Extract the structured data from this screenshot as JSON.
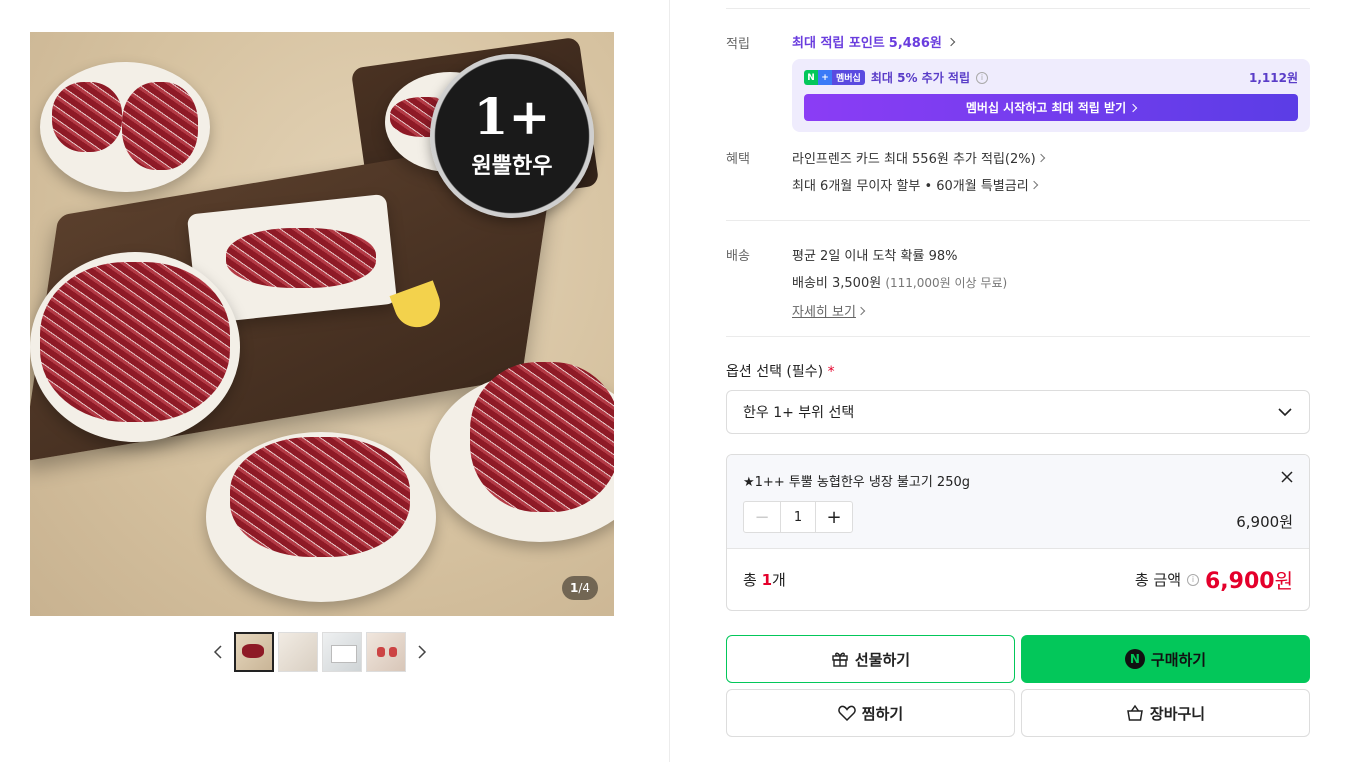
{
  "gallery": {
    "badge_main": "1+",
    "badge_sub": "원뿔한우",
    "counter_current": "1",
    "counter_sep": "/",
    "counter_total": "4",
    "thumbnails": [
      "thumb-1",
      "thumb-2",
      "thumb-3",
      "thumb-4"
    ]
  },
  "points": {
    "label": "적립",
    "max_text": "최대 적립 포인트",
    "max_amount": "5,486원",
    "member_badge_n": "N",
    "member_badge_plus": "+",
    "member_badge_text": "멤버십",
    "member_extra_text": "최대 5% 추가 적립",
    "member_extra_amount": "1,112원",
    "member_button": "멤버십 시작하고 최대 적립 받기"
  },
  "benefit": {
    "label": "혜택",
    "lines": [
      "라인프렌즈 카드 최대 556원 추가 적립(2%)",
      "최대 6개월 무이자 할부 • 60개월 특별금리"
    ]
  },
  "shipping": {
    "label": "배송",
    "line1": "평균 2일 이내 도착 확률 98%",
    "line2_main": "배송비 3,500원",
    "line2_sub": "(111,000원 이상 무료)",
    "detail_link": "자세히 보기"
  },
  "option": {
    "title": "옵션 선택 (필수)",
    "required_mark": "*",
    "select_value": "한우 1+ 부위 선택"
  },
  "selected": {
    "name": "★1++ 투뿔 농협한우 냉장 불고기 250g",
    "quantity": "1",
    "price": "6,900원"
  },
  "total": {
    "count_prefix": "총",
    "count_num": "1",
    "count_suffix": "개",
    "amount_label": "총 금액",
    "amount_value": "6,900",
    "amount_unit": "원"
  },
  "actions": {
    "gift": "선물하기",
    "buy": "구매하기",
    "buy_logo": "N",
    "wish": "찜하기",
    "cart": "장바구니"
  },
  "colors": {
    "accent_green": "#03c75a",
    "accent_purple": "#6a3dde",
    "price_red": "#e4002b"
  }
}
